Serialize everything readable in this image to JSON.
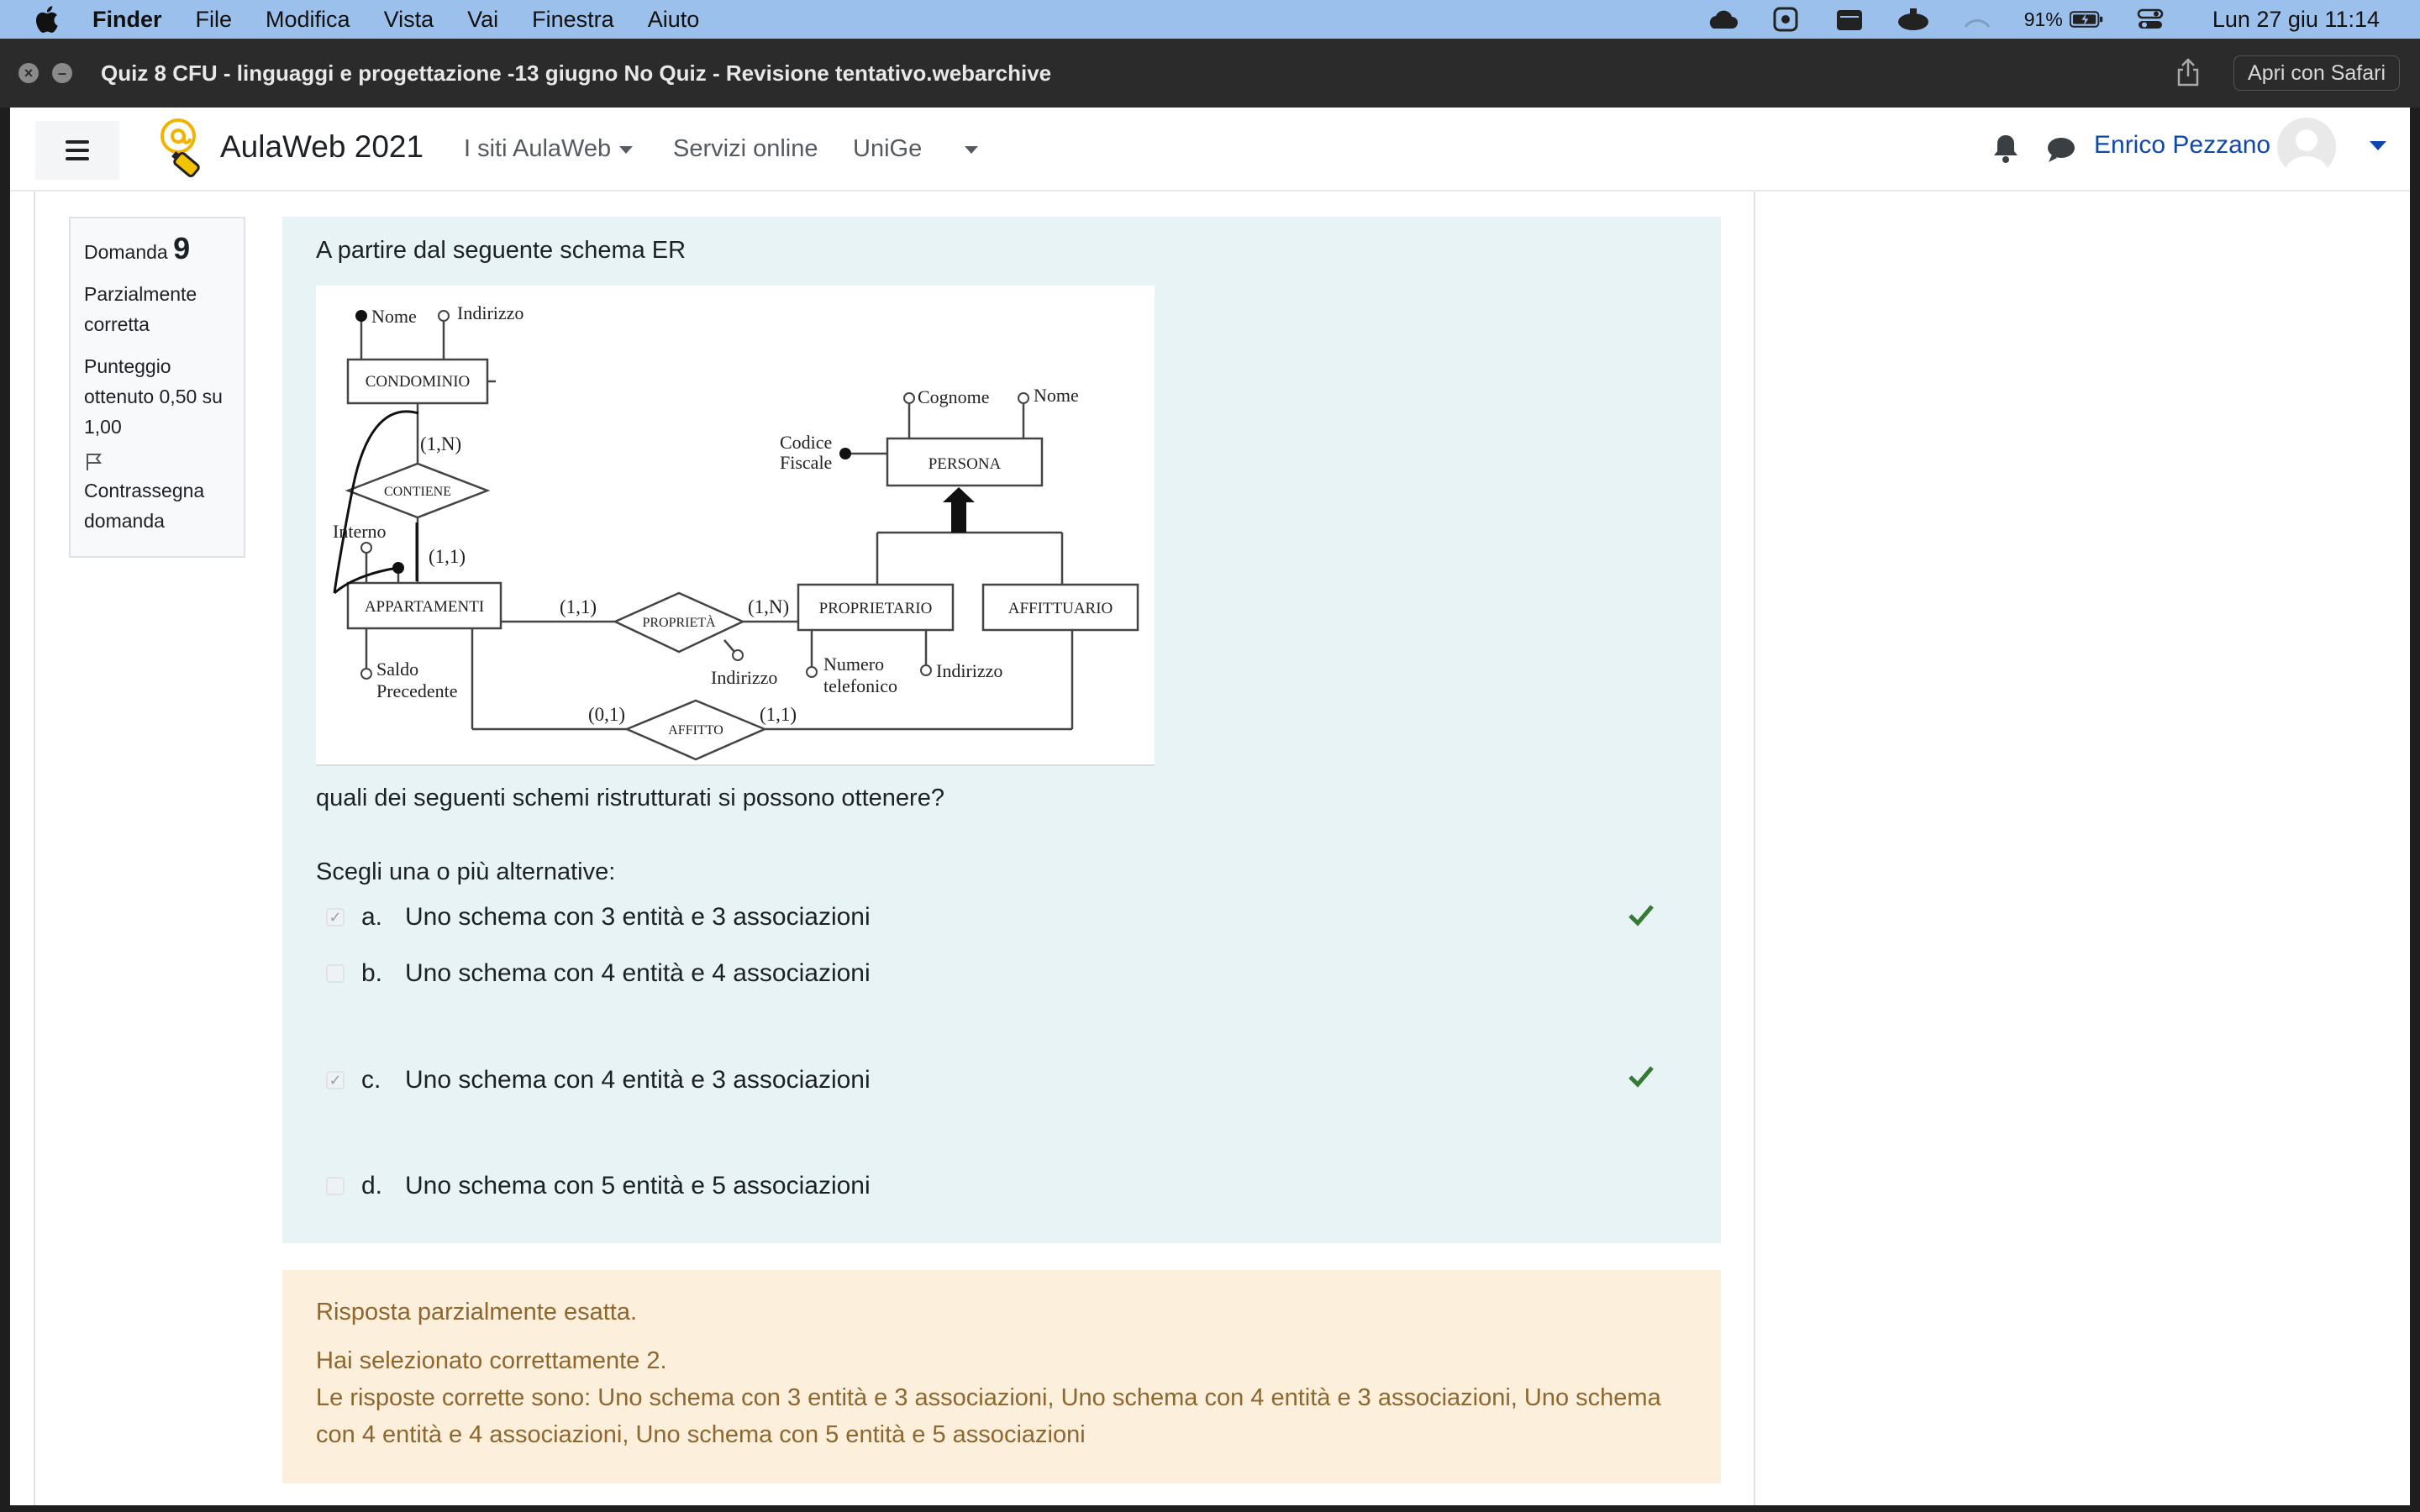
{
  "menubar": {
    "app": "Finder",
    "items": [
      "File",
      "Modifica",
      "Vista",
      "Vai",
      "Finestra",
      "Aiuto"
    ],
    "battery": "91%",
    "clock": "Lun 27 giu  11:14"
  },
  "window": {
    "title": "Quiz 8 CFU - linguaggi e progettazione -13 giugno No Quiz - Revisione tentativo.webarchive",
    "open_button": "Apri con Safari"
  },
  "navbar": {
    "site_name": "AulaWeb 2021",
    "links": [
      "I siti AulaWeb",
      "Servizi online",
      "UniGe"
    ],
    "user_name": "Enrico Pezzano"
  },
  "question_info": {
    "label": "Domanda",
    "number": "9",
    "state": "Parzialmente corretta",
    "score": "Punteggio ottenuto 0,50 su 1,00",
    "flag_label": "Contrassegna domanda"
  },
  "question": {
    "intro": "A partire dal seguente schema ER",
    "followup": "quali dei seguenti schemi ristrutturati si possono ottenere?",
    "prompt": "Scegli una o più alternative:",
    "options": [
      {
        "letter": "a.",
        "text": "Uno schema con 3 entità e 3 associazioni",
        "checked": true,
        "correct_mark": true
      },
      {
        "letter": "b.",
        "text": "Uno schema con 4 entità e 4 associazioni",
        "checked": false,
        "correct_mark": false
      },
      {
        "letter": "c.",
        "text": "Uno schema con 4 entità e 3 associazioni",
        "checked": true,
        "correct_mark": true
      },
      {
        "letter": "d.",
        "text": "Uno schema con 5 entità e 5 associazioni",
        "checked": false,
        "correct_mark": false
      }
    ]
  },
  "er_diagram": {
    "entities": [
      "CONDOMINIO",
      "APPARTAMENTI",
      "PERSONA",
      "PROPRIETARIO",
      "AFFITTUARIO"
    ],
    "relationships": [
      "CONTIENE",
      "PROPRIETÀ",
      "AFFITTO"
    ],
    "attributes": [
      "Nome",
      "Indirizzo",
      "Interno",
      "Saldo",
      "Precedente",
      "Cognome",
      "Nome",
      "Codice",
      "Fiscale",
      "Indirizzo",
      "Numero",
      "telefonico",
      "Indirizzo"
    ],
    "cardinalities": [
      "(1,N)",
      "(1,1)",
      "(1,1)",
      "(1,N)",
      "(0,1)",
      "(1,1)"
    ]
  },
  "feedback": {
    "summary": "Risposta parzialmente esatta.",
    "selected": "Hai selezionato correttamente 2.",
    "correct": "Le risposte corrette sono: Uno schema con 3 entità e 3 associazioni, Uno schema con 4 entità e 3 associazioni, Uno schema con 4 entità e 4 associazioni, Uno schema con 5 entità e 5 associazioni"
  },
  "colors": {
    "menubar": "#9bc0ec",
    "question_bg": "#e7f3f5",
    "feedback_bg": "#fcefdc",
    "feedback_text": "#8e662e",
    "link": "#0f47ad",
    "correct_tick": "#357a32"
  }
}
